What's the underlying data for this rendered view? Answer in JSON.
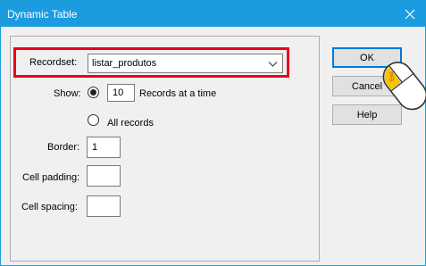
{
  "window": {
    "title": "Dynamic Table"
  },
  "form": {
    "recordset_label": "Recordset:",
    "recordset_value": "listar_produtos",
    "show_label": "Show:",
    "records_count": "10",
    "records_suffix": "Records at a time",
    "all_records_label": "All records",
    "show_selected": "records_at_a_time",
    "border_label": "Border:",
    "border_value": "1",
    "cell_padding_label": "Cell padding:",
    "cell_padding_value": "",
    "cell_spacing_label": "Cell spacing:",
    "cell_spacing_value": ""
  },
  "buttons": {
    "ok": "OK",
    "cancel": "Cancel",
    "help": "Help"
  },
  "colors": {
    "title_bar": "#1b9be0",
    "highlight": "#e8001c",
    "cursor_accent": "#f6c400"
  },
  "icons": {
    "close": "close-icon",
    "dropdown": "chevron-down-icon",
    "cursor": "mouse-cursor-icon"
  }
}
